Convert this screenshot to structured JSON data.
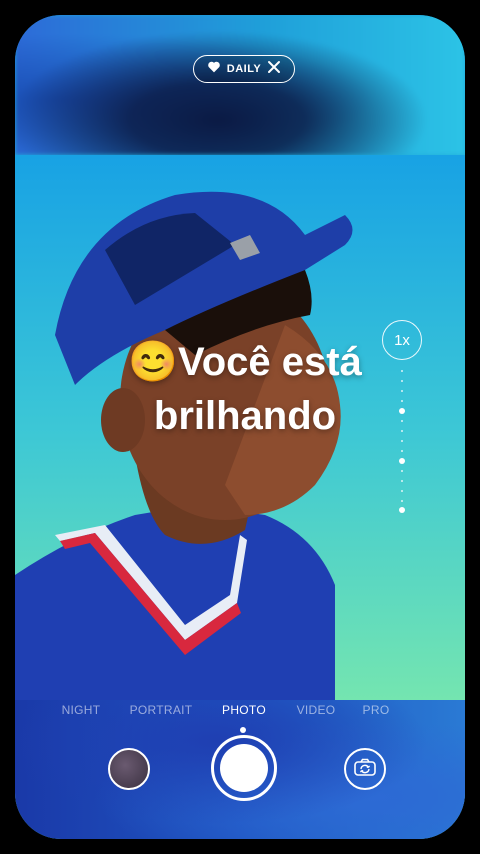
{
  "daily_chip": {
    "label": "DAILY",
    "icon": "heart-icon",
    "close_icon": "close-icon"
  },
  "caption": {
    "line1": "Você está",
    "line2": "brilhando",
    "emoji": "😊"
  },
  "zoom": {
    "label": "1x"
  },
  "modes": [
    {
      "label": "NIGHT",
      "active": false
    },
    {
      "label": "PORTRAIT",
      "active": false
    },
    {
      "label": "PHOTO",
      "active": true
    },
    {
      "label": "VIDEO",
      "active": false
    },
    {
      "label": "PRO",
      "active": false
    }
  ],
  "colors": {
    "accent": "#ffffff",
    "sky_top": "#18a2e4",
    "sky_bottom": "#74e5b0",
    "shirt": "#1f3fb2"
  }
}
